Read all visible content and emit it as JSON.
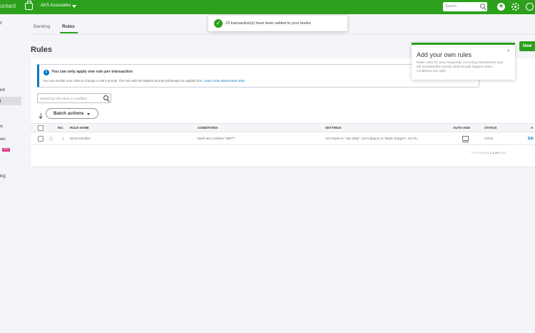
{
  "app": {
    "brand_fragment": "untant",
    "company_name": "AKS Associates"
  },
  "topbar": {
    "search_placeholder": "Search",
    "plus_symbol": "+"
  },
  "left_nav": {
    "items": [
      "ct",
      "ard",
      "g",
      "ec",
      "ees",
      "ting"
    ],
    "new_badge": "NEW"
  },
  "tabs": [
    {
      "label": "Banking",
      "active": false
    },
    {
      "label": "Rules",
      "active": true
    }
  ],
  "toast": {
    "message": "23 transaction(s) have been added to your books"
  },
  "page": {
    "title": "Rules",
    "new_button": "New"
  },
  "info": {
    "title": "You can only apply one rule per transaction",
    "body": "You can reorder your rules to change a rule's priority. The rule with the highest priority will always be applied first.",
    "link": "Learn more about bank rules"
  },
  "search": {
    "placeholder": "Search by rule name or condition"
  },
  "batch_actions": {
    "label": "Batch actions"
  },
  "table": {
    "columns": [
      "NO.",
      "RULE NAME",
      "CONDITIONS",
      "SETTINGS",
      "AUTO-ADD",
      "STATUS",
      "A"
    ],
    "rows": [
      {
        "no": "1",
        "rule_name": "Direct transfer",
        "conditions": "Bank text contains \"NEFT\"",
        "settings": "Set Payee to \"Abc daily\", set Category to \"Bank charges\", set Ta...",
        "status": "Active",
        "action": "Edi"
      }
    ]
  },
  "pagination": {
    "first": "First",
    "previous": "Previous",
    "current": "1-1 of 1",
    "next": "Next"
  },
  "popover": {
    "title": "Add your own rules",
    "close_symbol": "×",
    "body": "Make rules for your frequently occurring transactions and tell QuickBooks exactly what should happen when conditions are right."
  }
}
